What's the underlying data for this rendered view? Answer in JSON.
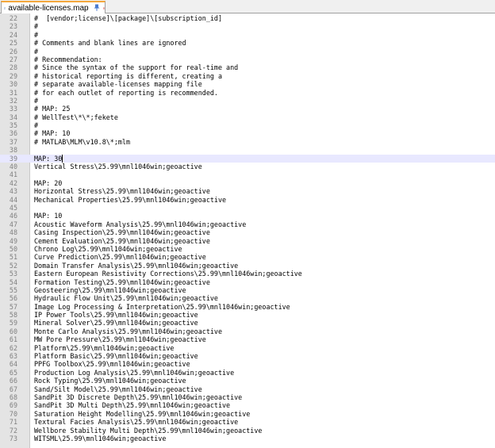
{
  "tab": {
    "title": "available-licenses.map",
    "icon": "file-icon",
    "pin_glyph": "⯐",
    "accent_color": "#f4a73b",
    "close_color": "#d03a3a"
  },
  "editor": {
    "current_line": 39,
    "lines": [
      {
        "num": "22",
        "text": "#  [vendor;license]\\[package]\\[subscription_id]"
      },
      {
        "num": "23",
        "text": "#"
      },
      {
        "num": "24",
        "text": "#"
      },
      {
        "num": "25",
        "text": "# Comments and blank lines are ignored"
      },
      {
        "num": "26",
        "text": "#"
      },
      {
        "num": "27",
        "text": "# Recommendation:"
      },
      {
        "num": "28",
        "text": "# Since the syntax of the support for real-time and"
      },
      {
        "num": "29",
        "text": "# historical reporting is different, creating a"
      },
      {
        "num": "30",
        "text": "# separate available-licenses mapping file"
      },
      {
        "num": "31",
        "text": "# for each outlet of reporting is recommended."
      },
      {
        "num": "32",
        "text": "#"
      },
      {
        "num": "33",
        "text": "# MAP: 25"
      },
      {
        "num": "34",
        "text": "# WellTest\\*\\*;fekete"
      },
      {
        "num": "35",
        "text": "#"
      },
      {
        "num": "36",
        "text": "# MAP: 10"
      },
      {
        "num": "37",
        "text": "# MATLAB\\MLM\\v10.8\\*;mlm"
      },
      {
        "num": "38",
        "text": ""
      },
      {
        "num": "39",
        "text": "MAP: 30"
      },
      {
        "num": "40",
        "text": "Vertical Stress\\25.99\\mnl1046win;geoactive"
      },
      {
        "num": "41",
        "text": ""
      },
      {
        "num": "42",
        "text": "MAP: 20"
      },
      {
        "num": "43",
        "text": "Horizontal Stress\\25.99\\mnl1046win;geoactive"
      },
      {
        "num": "44",
        "text": "Mechanical Properties\\25.99\\mnl1046win;geoactive"
      },
      {
        "num": "45",
        "text": ""
      },
      {
        "num": "46",
        "text": "MAP: 10"
      },
      {
        "num": "47",
        "text": "Acoustic Waveform Analysis\\25.99\\mnl1046win;geoactive"
      },
      {
        "num": "48",
        "text": "Casing Inspection\\25.99\\mnl1046win;geoactive"
      },
      {
        "num": "49",
        "text": "Cement Evaluation\\25.99\\mnl1046win;geoactive"
      },
      {
        "num": "50",
        "text": "Chrono Log\\25.99\\mnl1046win;geoactive"
      },
      {
        "num": "51",
        "text": "Curve Prediction\\25.99\\mnl1046win;geoactive"
      },
      {
        "num": "52",
        "text": "Domain Transfer Analysis\\25.99\\mnl1046win;geoactive"
      },
      {
        "num": "53",
        "text": "Eastern European Resistivity Corrections\\25.99\\mnl1046win;geoactive"
      },
      {
        "num": "54",
        "text": "Formation Testing\\25.99\\mnl1046win;geoactive"
      },
      {
        "num": "55",
        "text": "Geosteering\\25.99\\mnl1046win;geoactive"
      },
      {
        "num": "56",
        "text": "Hydraulic Flow Unit\\25.99\\mnl1046win;geoactive"
      },
      {
        "num": "57",
        "text": "Image Log Processing & Interpretation\\25.99\\mnl1046win;geoactive"
      },
      {
        "num": "58",
        "text": "IP Power Tools\\25.99\\mnl1046win;geoactive"
      },
      {
        "num": "59",
        "text": "Mineral Solver\\25.99\\mnl1046win;geoactive"
      },
      {
        "num": "60",
        "text": "Monte Carlo Analysis\\25.99\\mnl1046win;geoactive"
      },
      {
        "num": "61",
        "text": "MW Pore Pressure\\25.99\\mnl1046win;geoactive"
      },
      {
        "num": "62",
        "text": "Platform\\25.99\\mnl1046win;geoactive"
      },
      {
        "num": "63",
        "text": "Platform Basic\\25.99\\mnl1046win;geoactive"
      },
      {
        "num": "64",
        "text": "PPFG Toolbox\\25.99\\mnl1046win;geoactive"
      },
      {
        "num": "65",
        "text": "Production Log Analysis\\25.99\\mnl1046win;geoactive"
      },
      {
        "num": "66",
        "text": "Rock Typing\\25.99\\mnl1046win;geoactive"
      },
      {
        "num": "67",
        "text": "Sand/Silt Model\\25.99\\mnl1046win;geoactive"
      },
      {
        "num": "68",
        "text": "SandPit 3D Discrete Depth\\25.99\\mnl1046win;geoactive"
      },
      {
        "num": "69",
        "text": "SandPit 3D Multi Depth\\25.99\\mnl1046win;geoactive"
      },
      {
        "num": "70",
        "text": "Saturation Height Modelling\\25.99\\mnl1046win;geoactive"
      },
      {
        "num": "71",
        "text": "Textural Facies Analysis\\25.99\\mnl1046win;geoactive"
      },
      {
        "num": "72",
        "text": "Wellbore Stability Multi Depth\\25.99\\mnl1046win;geoactive"
      },
      {
        "num": "73",
        "text": "WITSML\\25.99\\mnl1046win;geoactive"
      }
    ]
  }
}
